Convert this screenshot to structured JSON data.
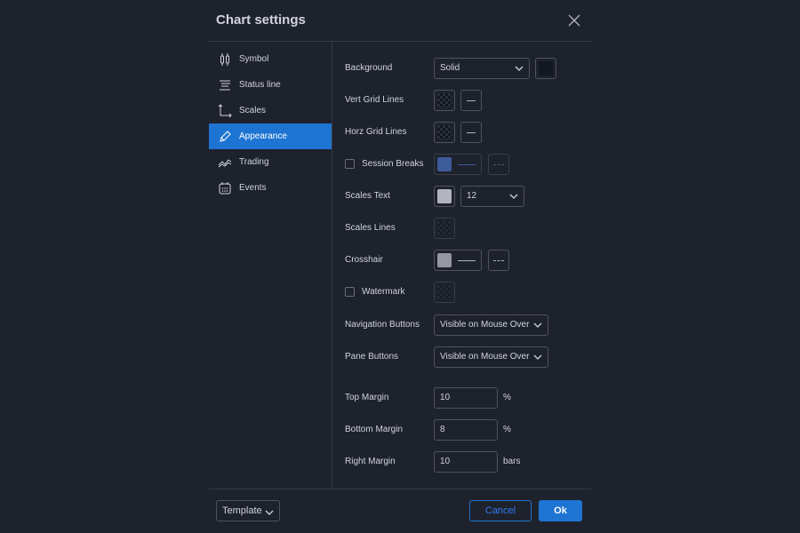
{
  "dialog": {
    "title": "Chart settings"
  },
  "sidebar": {
    "items": [
      {
        "label": "Symbol",
        "icon": "candles-icon"
      },
      {
        "label": "Status line",
        "icon": "status-line-icon"
      },
      {
        "label": "Scales",
        "icon": "scales-icon"
      },
      {
        "label": "Appearance",
        "icon": "pencil-icon",
        "active": true
      },
      {
        "label": "Trading",
        "icon": "trading-icon"
      },
      {
        "label": "Events",
        "icon": "calendar-icon"
      }
    ]
  },
  "appearance": {
    "background": {
      "label": "Background",
      "type": "Solid"
    },
    "vert_grid": {
      "label": "Vert Grid Lines"
    },
    "horz_grid": {
      "label": "Horz Grid Lines"
    },
    "session_breaks": {
      "label": "Session Breaks",
      "checked": false
    },
    "scales_text": {
      "label": "Scales Text",
      "size": "12"
    },
    "scales_lines": {
      "label": "Scales Lines"
    },
    "crosshair": {
      "label": "Crosshair"
    },
    "watermark": {
      "label": "Watermark",
      "checked": false
    },
    "navigation_buttons": {
      "label": "Navigation Buttons",
      "value": "Visible on Mouse Over"
    },
    "pane_buttons": {
      "label": "Pane Buttons",
      "value": "Visible on Mouse Over"
    },
    "top_margin": {
      "label": "Top Margin",
      "value": "10",
      "unit": "%"
    },
    "bottom_margin": {
      "label": "Bottom Margin",
      "value": "8",
      "unit": "%"
    },
    "right_margin": {
      "label": "Right Margin",
      "value": "10",
      "unit": "bars"
    }
  },
  "footer": {
    "template_label": "Template",
    "cancel_label": "Cancel",
    "ok_label": "Ok"
  },
  "colors": {
    "accent": "#1e74d2",
    "session_breaks_color": "#3d5a99",
    "scales_text_color": "#b2b5be",
    "crosshair_color": "#9598a1"
  }
}
